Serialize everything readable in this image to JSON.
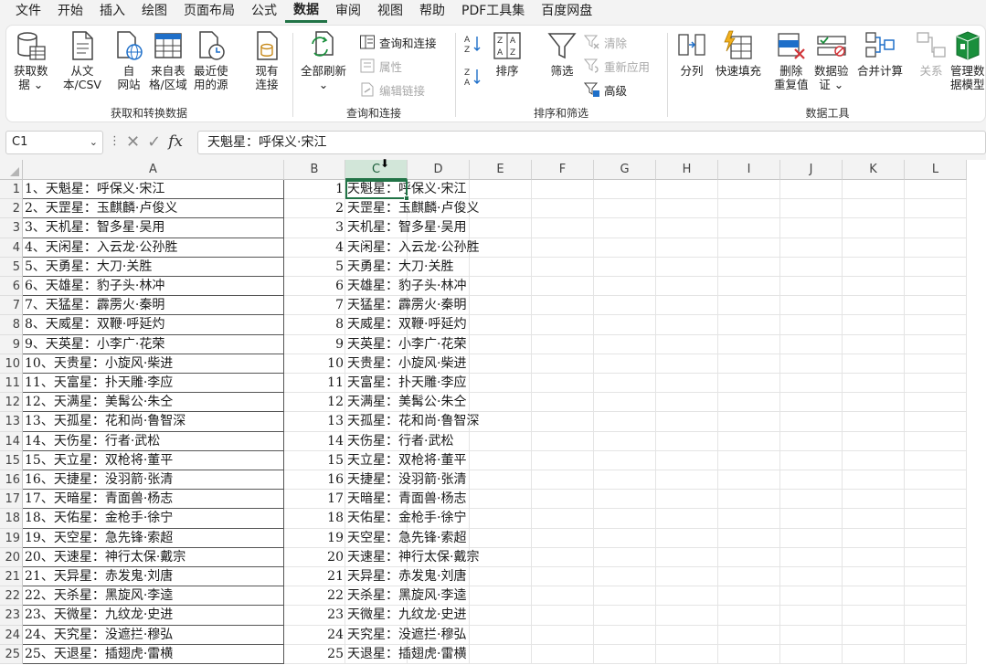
{
  "menu": [
    "文件",
    "开始",
    "插入",
    "绘图",
    "页面布局",
    "公式",
    "数据",
    "审阅",
    "视图",
    "帮助",
    "PDF工具集",
    "百度网盘"
  ],
  "active_menu": "数据",
  "ribbon": {
    "get_data": {
      "line1": "获取数",
      "line2": "据 ⌄"
    },
    "from_text": {
      "line1": "从文",
      "line2": "本/CSV"
    },
    "from_web": {
      "line1": "自",
      "line2": "网站"
    },
    "from_table": {
      "line1": "来自表",
      "line2": "格/区域"
    },
    "recent_sources": {
      "line1": "最近使",
      "line2": "用的源"
    },
    "existing_conn": {
      "line1": "现有",
      "line2": "连接"
    },
    "group1_label": "获取和转换数据",
    "refresh_all": {
      "line1": "全部刷新",
      "line2": "⌄"
    },
    "queries_conn": "查询和连接",
    "properties": "属性",
    "edit_links": "编辑链接",
    "group2_label": "查询和连接",
    "sort": "排序",
    "filter": "筛选",
    "clear": "清除",
    "reapply": "重新应用",
    "advanced": "高级",
    "group3_label": "排序和筛选",
    "split": "分列",
    "flash_fill": "快速填充",
    "remove_dup": {
      "line1": "删除",
      "line2": "重复值"
    },
    "data_validation": {
      "line1": "数据验",
      "line2": "证 ⌄"
    },
    "consolidate": "合并计算",
    "relationships": "关系",
    "data_model": {
      "line1": "管理数",
      "line2": "据模型"
    },
    "group4_label": "数据工具"
  },
  "formula_bar": {
    "name_box": "C1",
    "content": "天魁星：呼保义·宋江"
  },
  "columns": [
    "A",
    "B",
    "C",
    "D",
    "E",
    "F",
    "G",
    "H",
    "I",
    "J",
    "K",
    "L"
  ],
  "selected_column": "C",
  "rows": [
    {
      "n": "1",
      "a": "1、天魁星：呼保义·宋江",
      "b": "1",
      "c": "天魁星：呼保义·宋江"
    },
    {
      "n": "2",
      "a": "2、天罡星：玉麒麟·卢俊义",
      "b": "2",
      "c": "天罡星：玉麒麟·卢俊义"
    },
    {
      "n": "3",
      "a": "3、天机星：智多星·吴用",
      "b": "3",
      "c": "天机星：智多星·吴用"
    },
    {
      "n": "4",
      "a": "4、天闲星：入云龙·公孙胜",
      "b": "4",
      "c": "天闲星：入云龙·公孙胜"
    },
    {
      "n": "5",
      "a": "5、天勇星：大刀·关胜",
      "b": "5",
      "c": "天勇星：大刀·关胜"
    },
    {
      "n": "6",
      "a": "6、天雄星：豹子头·林冲",
      "b": "6",
      "c": "天雄星：豹子头·林冲"
    },
    {
      "n": "7",
      "a": "7、天猛星：霹雳火·秦明",
      "b": "7",
      "c": "天猛星：霹雳火·秦明"
    },
    {
      "n": "8",
      "a": "8、天威星：双鞭·呼延灼",
      "b": "8",
      "c": "天威星：双鞭·呼延灼"
    },
    {
      "n": "9",
      "a": "9、天英星：小李广·花荣",
      "b": "9",
      "c": "天英星：小李广·花荣"
    },
    {
      "n": "10",
      "a": "10、天贵星：小旋风·柴进",
      "b": "10",
      "c": "天贵星：小旋风·柴进"
    },
    {
      "n": "11",
      "a": "11、天富星：扑天雕·李应",
      "b": "11",
      "c": "天富星：扑天雕·李应"
    },
    {
      "n": "12",
      "a": "12、天满星：美髯公·朱仝",
      "b": "12",
      "c": "天满星：美髯公·朱仝"
    },
    {
      "n": "13",
      "a": "13、天孤星：花和尚·鲁智深",
      "b": "13",
      "c": "天孤星：花和尚·鲁智深"
    },
    {
      "n": "14",
      "a": "14、天伤星：行者·武松",
      "b": "14",
      "c": "天伤星：行者·武松"
    },
    {
      "n": "15",
      "a": "15、天立星：双枪将·董平",
      "b": "15",
      "c": "天立星：双枪将·董平"
    },
    {
      "n": "16",
      "a": "16、天捷星：没羽箭·张清",
      "b": "16",
      "c": "天捷星：没羽箭·张清"
    },
    {
      "n": "17",
      "a": "17、天暗星：青面兽·杨志",
      "b": "17",
      "c": "天暗星：青面兽·杨志"
    },
    {
      "n": "18",
      "a": "18、天佑星：金枪手·徐宁",
      "b": "18",
      "c": "天佑星：金枪手·徐宁"
    },
    {
      "n": "19",
      "a": "19、天空星：急先锋·索超",
      "b": "19",
      "c": "天空星：急先锋·索超"
    },
    {
      "n": "20",
      "a": "20、天速星：神行太保·戴宗",
      "b": "20",
      "c": "天速星：神行太保·戴宗"
    },
    {
      "n": "21",
      "a": "21、天异星：赤发鬼·刘唐",
      "b": "21",
      "c": "天异星：赤发鬼·刘唐"
    },
    {
      "n": "22",
      "a": "22、天杀星：黑旋风·李逵",
      "b": "22",
      "c": "天杀星：黑旋风·李逵"
    },
    {
      "n": "23",
      "a": "23、天微星：九纹龙·史进",
      "b": "23",
      "c": "天微星：九纹龙·史进"
    },
    {
      "n": "24",
      "a": "24、天究星：没遮拦·穆弘",
      "b": "24",
      "c": "天究星：没遮拦·穆弘"
    },
    {
      "n": "25",
      "a": "25、天退星：插翅虎·雷横",
      "b": "25",
      "c": "天退星：插翅虎·雷横"
    }
  ]
}
